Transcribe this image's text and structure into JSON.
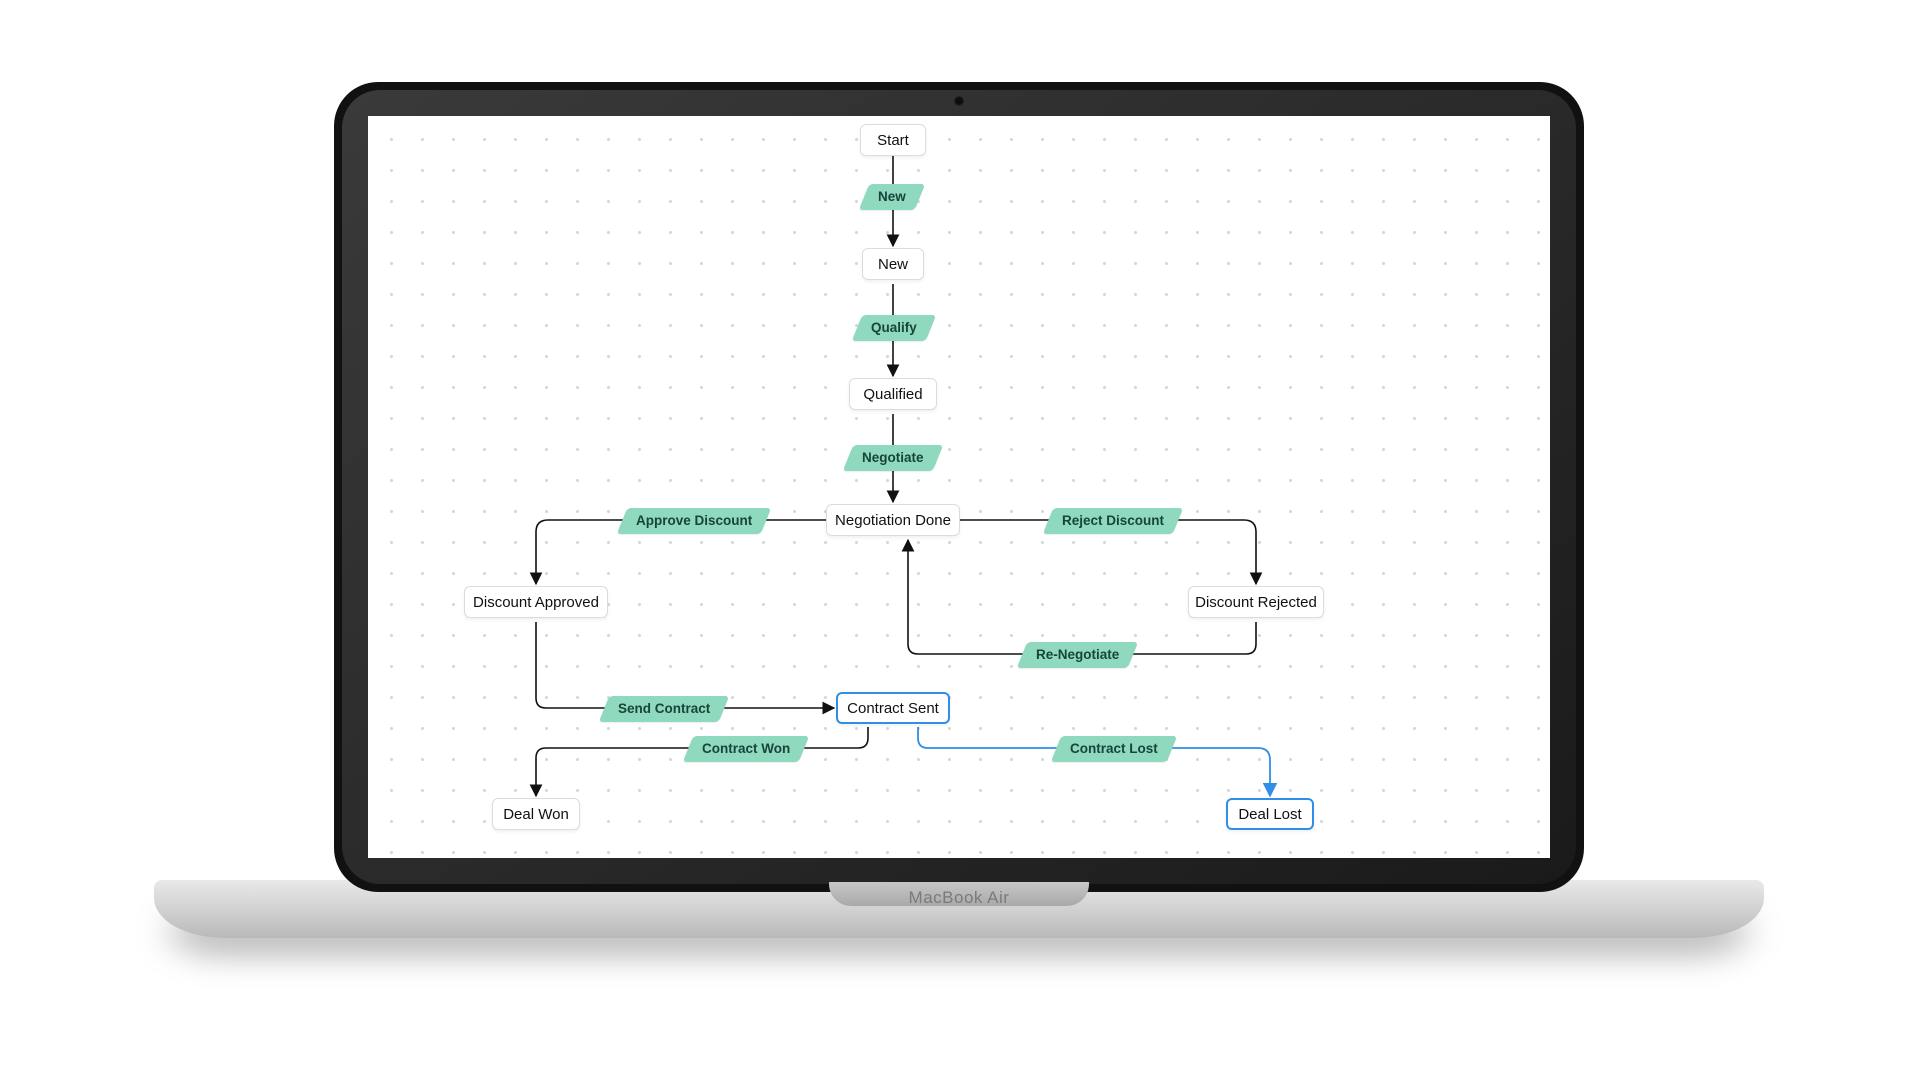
{
  "device": {
    "brand": "MacBook Air"
  },
  "diagram": {
    "nodes": {
      "start": {
        "label": "Start"
      },
      "new": {
        "label": "New"
      },
      "qualified": {
        "label": "Qualified"
      },
      "negotiation_done": {
        "label": "Negotiation Done"
      },
      "discount_approved": {
        "label": "Discount Approved"
      },
      "discount_rejected": {
        "label": "Discount Rejected"
      },
      "contract_sent": {
        "label": "Contract Sent"
      },
      "deal_won": {
        "label": "Deal Won"
      },
      "deal_lost": {
        "label": "Deal Lost"
      }
    },
    "transitions": {
      "t_new": {
        "label": "New"
      },
      "t_qualify": {
        "label": "Qualify"
      },
      "t_negotiate": {
        "label": "Negotiate"
      },
      "t_approve_disc": {
        "label": "Approve Discount"
      },
      "t_reject_disc": {
        "label": "Reject Discount"
      },
      "t_renegotiate": {
        "label": "Re-Negotiate"
      },
      "t_send_contract": {
        "label": "Send Contract"
      },
      "t_contract_won": {
        "label": "Contract Won"
      },
      "t_contract_lost": {
        "label": "Contract Lost"
      }
    },
    "selected_node": "contract_sent",
    "selected_edge": "t_contract_lost"
  }
}
